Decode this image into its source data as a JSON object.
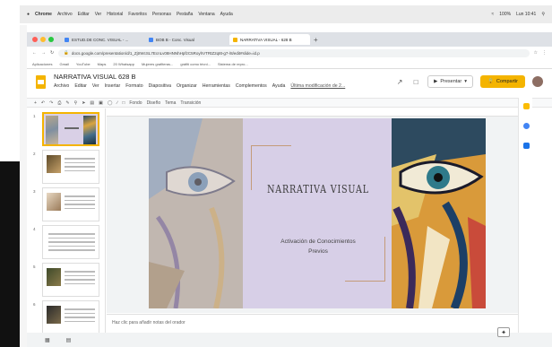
{
  "mac_menu": [
    "Chrome",
    "Archivo",
    "Editar",
    "Ver",
    "Historial",
    "Favoritos",
    "Personas",
    "Pestaña",
    "Ventana",
    "Ayuda"
  ],
  "mac_status": {
    "battery": "100%",
    "clock": "Lun 10:41"
  },
  "tabs": [
    {
      "label": "ESTUD.DE CONC. VISUAL - ..."
    },
    {
      "label": "BOB B - Conc. Visual"
    },
    {
      "label": "NARRATIVA VISUAL - 628 B"
    }
  ],
  "url": "docs.google.com/presentation/d/1_ZjtrWcSL7EcnLv08HNNhHpfzC5RoyhVTRtZ2q8t-g7-/8/edit#slide=id.p",
  "bookmarks": [
    "Aplicaciones",
    "Gmail",
    "YouTube",
    "Maps",
    "20 Whatsapp",
    "Mujeres grafiteras...",
    "gráfiti como técni...",
    "Sistema de repro..."
  ],
  "doc": {
    "title": "NARRATIVA VISUAL 628 B",
    "menus": [
      "Archivo",
      "Editar",
      "Ver",
      "Insertar",
      "Formato",
      "Diapositiva",
      "Organizar",
      "Herramientas",
      "Complementos",
      "Ayuda"
    ],
    "last_edit": "Última modificación de 2...",
    "present_label": "Presentar",
    "share_label": "Compartir"
  },
  "toolbar": {
    "fondo": "Fondo",
    "diseno": "Diseño",
    "tema": "Tema",
    "transicion": "Transición"
  },
  "slide": {
    "title": "NARRATIVA VISUAL",
    "subtitle_line1": "Activación de Conocimientos",
    "subtitle_line2": "Previos"
  },
  "thumbnails": [
    {
      "num": "1"
    },
    {
      "num": "2"
    },
    {
      "num": "3"
    },
    {
      "num": "4"
    },
    {
      "num": "5"
    },
    {
      "num": "6"
    }
  ],
  "notes_placeholder": "Haz clic para añadir notas del orador"
}
